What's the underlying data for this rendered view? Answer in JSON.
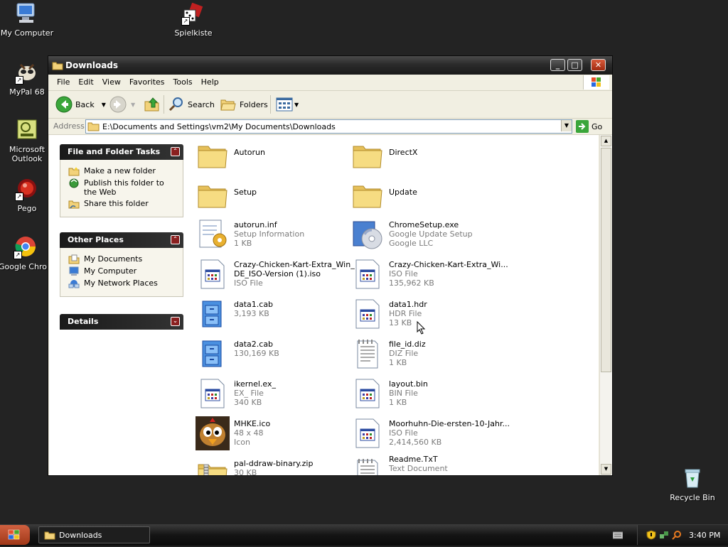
{
  "desktop": {
    "icons": [
      {
        "label": "My Computer"
      },
      {
        "label": "Spielkiste"
      },
      {
        "label": "MyPal 68"
      },
      {
        "label": "Microsoft Outlook"
      },
      {
        "label": "Pego"
      },
      {
        "label": "Google Chrome"
      },
      {
        "label": "Recycle Bin"
      }
    ]
  },
  "window": {
    "title": "Downloads",
    "menu": [
      "File",
      "Edit",
      "View",
      "Favorites",
      "Tools",
      "Help"
    ],
    "toolbar": {
      "back": "Back",
      "search": "Search",
      "folders": "Folders"
    },
    "address": {
      "label": "Address",
      "path": "E:\\Documents and Settings\\vm2\\My Documents\\Downloads",
      "go": "Go"
    }
  },
  "tasks": {
    "file_folder": {
      "title": "File and Folder Tasks",
      "items": [
        "Make a new folder",
        "Publish this folder to the Web",
        "Share this folder"
      ]
    },
    "other_places": {
      "title": "Other Places",
      "items": [
        "My Documents",
        "My Computer",
        "My Network Places"
      ]
    },
    "details": {
      "title": "Details"
    }
  },
  "files": [
    {
      "name": "Autorun",
      "line2": "",
      "line3": ""
    },
    {
      "name": "DirectX",
      "line2": "",
      "line3": ""
    },
    {
      "name": "Setup",
      "line2": "",
      "line3": ""
    },
    {
      "name": "Update",
      "line2": "",
      "line3": ""
    },
    {
      "name": "autorun.inf",
      "line2": "Setup Information",
      "line3": "1 KB"
    },
    {
      "name": "ChromeSetup.exe",
      "line2": "Google Update Setup",
      "line3": "Google LLC"
    },
    {
      "name": "Crazy-Chicken-Kart-Extra_Win_",
      "name2": "DE_ISO-Version (1).iso",
      "line2": "ISO File",
      "line3": ""
    },
    {
      "name": "Crazy-Chicken-Kart-Extra_Wi...",
      "line2": "ISO File",
      "line3": "135,962 KB"
    },
    {
      "name": "data1.cab",
      "line2": "3,193 KB",
      "line3": ""
    },
    {
      "name": "data1.hdr",
      "line2": "HDR File",
      "line3": "13 KB"
    },
    {
      "name": "data2.cab",
      "line2": "130,169 KB",
      "line3": ""
    },
    {
      "name": "file_id.diz",
      "line2": "DIZ File",
      "line3": "1 KB"
    },
    {
      "name": "ikernel.ex_",
      "line2": "EX_ File",
      "line3": "340 KB"
    },
    {
      "name": "layout.bin",
      "line2": "BIN File",
      "line3": "1 KB"
    },
    {
      "name": "MHKE.ico",
      "line2": "48 x 48",
      "line3": "Icon"
    },
    {
      "name": "Moorhuhn-Die-ersten-10-Jahr...",
      "line2": "ISO File",
      "line3": "2,414,560 KB"
    },
    {
      "name": "pal-ddraw-binary.zip",
      "line2": "30 KB",
      "line3": ""
    },
    {
      "name": "Readme.TxT",
      "line2": "Text Document",
      "line3": ""
    }
  ],
  "taskbar": {
    "window_button": "Downloads",
    "clock": "3:40 PM"
  }
}
